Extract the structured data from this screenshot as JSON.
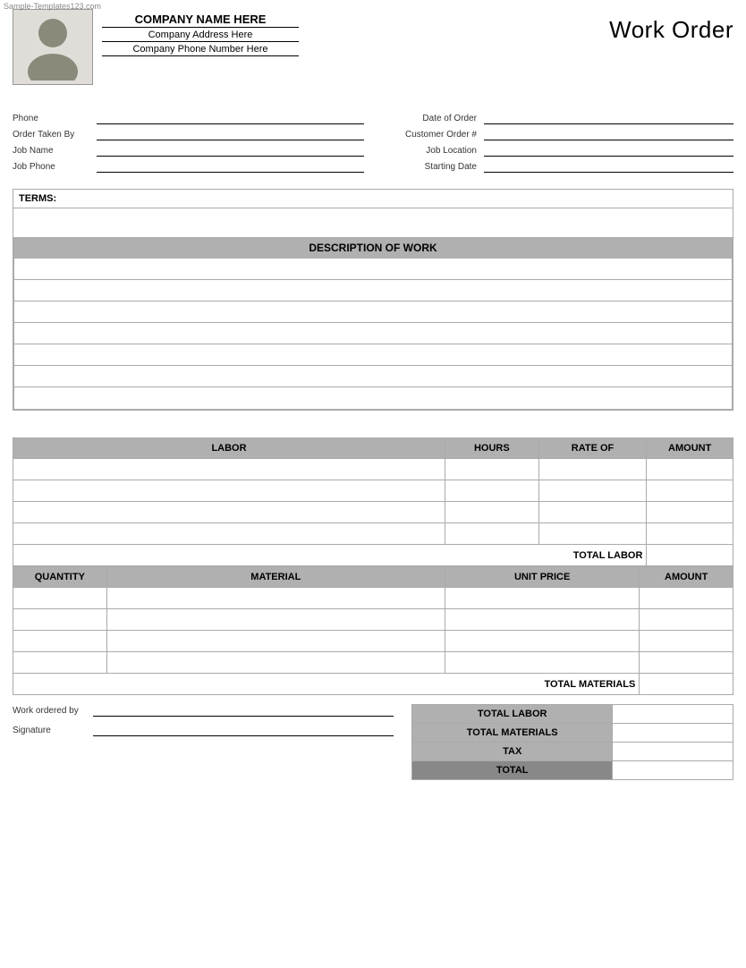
{
  "watermark": "Sample-Templates123.com",
  "header": {
    "company_name": "COMPANY NAME HERE",
    "company_address": "Company Address Here",
    "company_phone": "Company Phone Number Here",
    "title": "Work Order"
  },
  "form": {
    "left": [
      {
        "label": "Phone",
        "value": ""
      },
      {
        "label": "Order Taken By",
        "value": ""
      },
      {
        "label": "Job Name",
        "value": ""
      },
      {
        "label": "Job Phone",
        "value": ""
      }
    ],
    "right": [
      {
        "label": "Date of Order",
        "value": ""
      },
      {
        "label": "Customer Order #",
        "value": ""
      },
      {
        "label": "Job Location",
        "value": ""
      },
      {
        "label": "Starting Date",
        "value": ""
      }
    ]
  },
  "terms": {
    "label": "TERMS:"
  },
  "description_of_work": {
    "header": "DESCRIPTION OF WORK",
    "rows": 7
  },
  "labor": {
    "columns": [
      "LABOR",
      "HOURS",
      "RATE OF",
      "AMOUNT"
    ],
    "rows": 4,
    "total_label": "TOTAL LABOR"
  },
  "materials": {
    "columns": [
      "QUANTITY",
      "MATERIAL",
      "UNIT PRICE",
      "AMOUNT"
    ],
    "rows": 4,
    "total_label": "TOTAL MATERIALS"
  },
  "totals": {
    "rows": [
      {
        "label": "TOTAL LABOR",
        "value": ""
      },
      {
        "label": "TOTAL MATERIALS",
        "value": ""
      },
      {
        "label": "TAX",
        "value": ""
      },
      {
        "label": "TOTAL",
        "value": "",
        "grand": true
      }
    ]
  },
  "signature": {
    "work_ordered_by": "Work ordered by",
    "signature": "Signature"
  }
}
